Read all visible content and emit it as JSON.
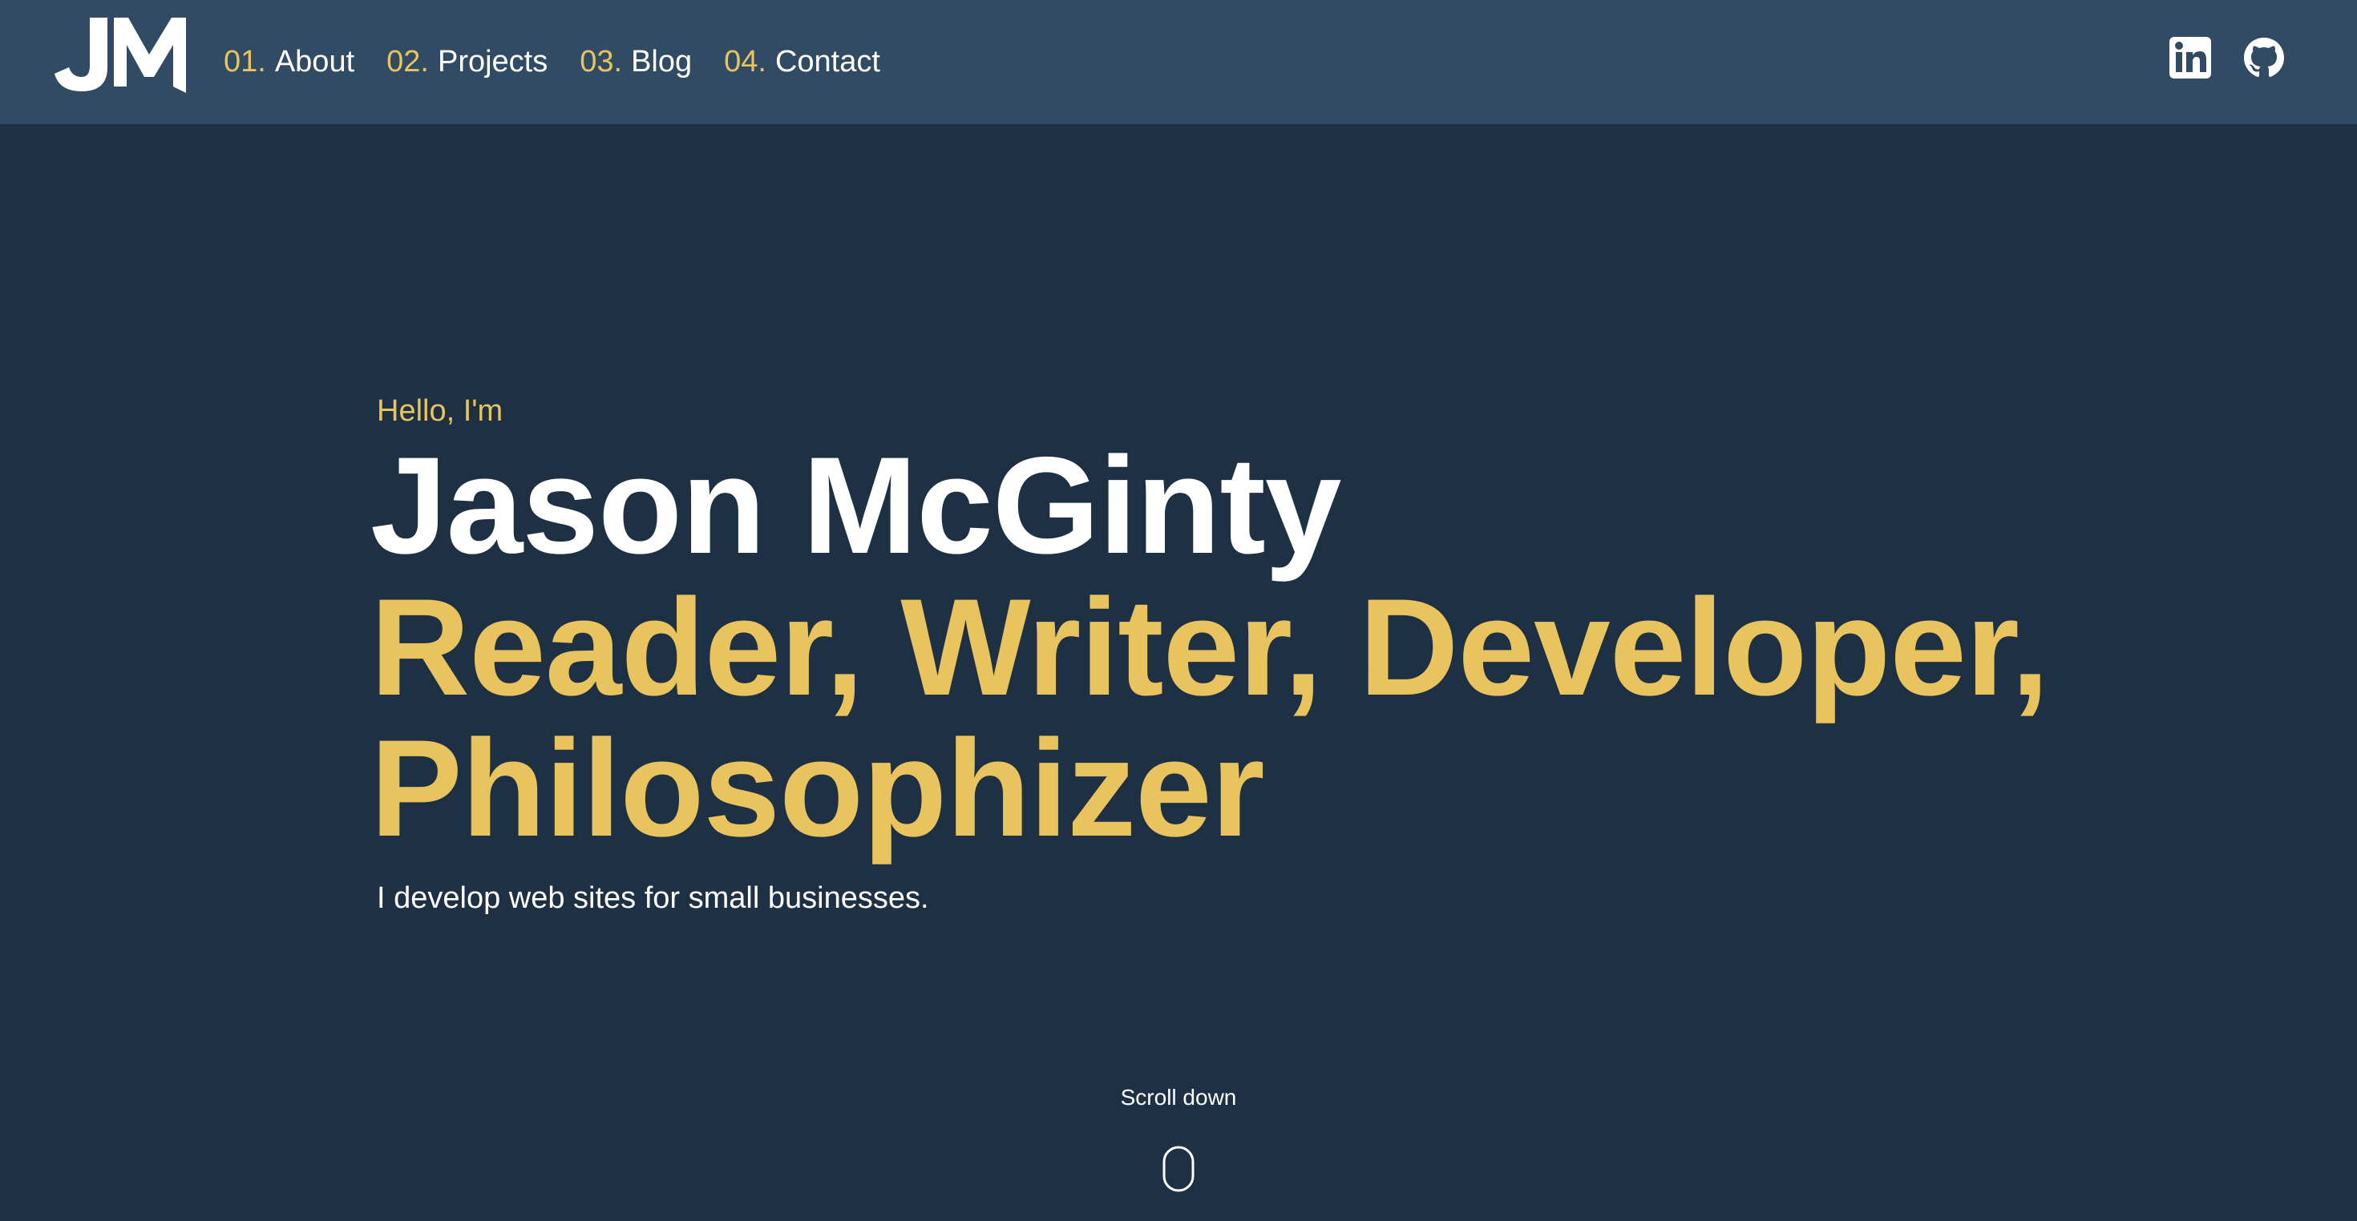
{
  "colors": {
    "header_bg": "#304b63",
    "page_bg": "#1e3043",
    "accent": "#e9c35d",
    "text": "#ffffff"
  },
  "header": {
    "logo_icon": "jm-logo",
    "nav": [
      {
        "number": "01.",
        "label": "About"
      },
      {
        "number": "02.",
        "label": "Projects"
      },
      {
        "number": "03.",
        "label": "Blog"
      },
      {
        "number": "04.",
        "label": "Contact"
      }
    ],
    "social": [
      {
        "icon": "linkedin-icon"
      },
      {
        "icon": "github-icon"
      }
    ]
  },
  "hero": {
    "greeting": "Hello, I'm",
    "name": "Jason McGinty",
    "roles": "Reader, Writer, Developer, Philosophizer",
    "tagline": "I develop web sites for small businesses."
  },
  "scroll": {
    "label": "Scroll down",
    "icon": "mouse-scroll-icon"
  }
}
